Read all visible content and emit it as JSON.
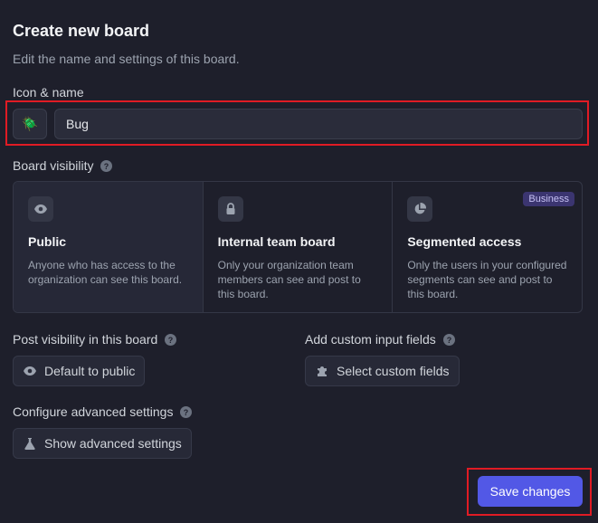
{
  "header": {
    "title": "Create new board",
    "subtitle": "Edit the name and settings of this board."
  },
  "icon_name": {
    "label": "Icon & name",
    "icon": "beetle-emoji",
    "emoji": "🪲",
    "value": "Bug"
  },
  "visibility": {
    "label": "Board visibility",
    "options": [
      {
        "title": "Public",
        "description": "Anyone who has access to the organization can see this board.",
        "icon": "eye-icon",
        "selected": true
      },
      {
        "title": "Internal team board",
        "description": "Only your organization team members can see and post to this board.",
        "icon": "lock-icon",
        "selected": false
      },
      {
        "title": "Segmented access",
        "description": "Only the users in your configured segments can see and post to this board.",
        "icon": "pie-chart-icon",
        "selected": false,
        "badge": "Business"
      }
    ]
  },
  "post_visibility": {
    "label": "Post visibility in this board",
    "button": "Default to public"
  },
  "custom_fields": {
    "label": "Add custom input fields",
    "button": "Select custom fields"
  },
  "advanced": {
    "label": "Configure advanced settings",
    "button": "Show advanced settings"
  },
  "footer": {
    "save": "Save changes"
  },
  "colors": {
    "background": "#1e1f2b",
    "accent": "#5258e6",
    "highlight": "#e01b24"
  }
}
